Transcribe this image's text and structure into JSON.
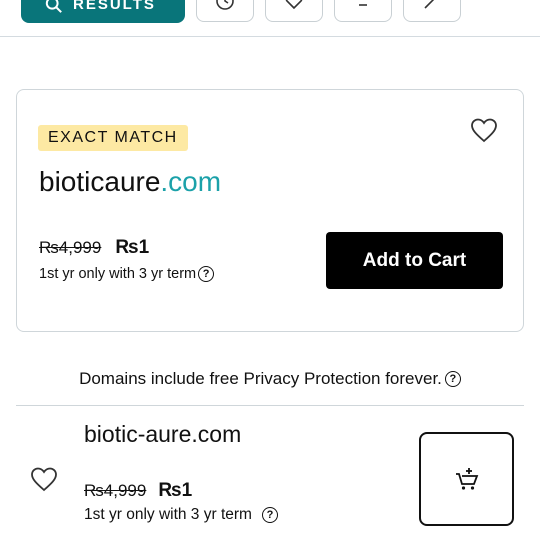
{
  "toolbar": {
    "results_label": "RESULTS",
    "icons": [
      "search-icon",
      "clock-icon",
      "heart-icon",
      "minus-icon",
      "sparkle-wand-icon"
    ]
  },
  "exact_match": {
    "badge": "EXACT MATCH",
    "domain_name": "bioticaure",
    "domain_tld": ".com",
    "old_price": "₨4,999",
    "new_price": "₨1",
    "term": "1st yr only with 3 yr term",
    "button_label": "Add to Cart"
  },
  "privacy_note": "Domains include free Privacy Protection forever.",
  "results": [
    {
      "domain": "biotic-aure.com",
      "old_price": "₨4,999",
      "new_price": "₨1",
      "term": "1st yr only with 3 yr term"
    }
  ],
  "colors": {
    "brand_teal": "#09757a",
    "tld_teal": "#1ba1a9",
    "badge_yellow": "#fde9a3",
    "button_black": "#000000"
  }
}
